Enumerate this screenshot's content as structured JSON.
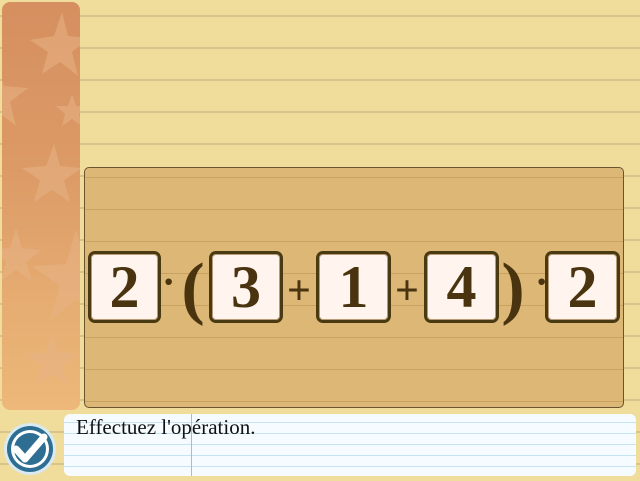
{
  "colors": {
    "background": "#f0dd9c",
    "panel": "#dcb776",
    "tile_fill": "#fff4ee",
    "tile_text": "#4a3410",
    "sidebar": "#dc9a66",
    "ok_button": "#2e6e92"
  },
  "expression": {
    "tile_1": "2",
    "op_1": "·",
    "open_paren": "(",
    "tile_2": "3",
    "op_2": "+",
    "tile_3": "1",
    "op_3": "+",
    "tile_4": "4",
    "close_paren": ")",
    "op_4": "·",
    "tile_5": "2"
  },
  "instruction": {
    "text": "Effectuez l'opération."
  },
  "icons": {
    "ok_button": "checkmark-icon",
    "sidebar_decoration": "star-icon"
  }
}
